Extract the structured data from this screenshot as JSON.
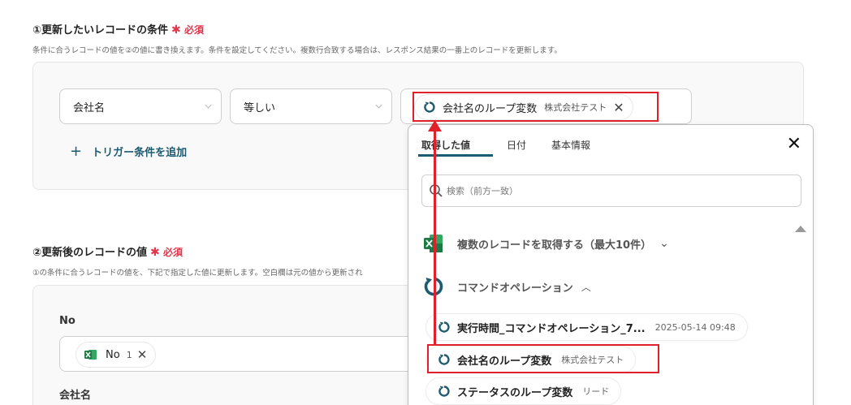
{
  "section1": {
    "title": "①更新したいレコードの条件",
    "required_star": "✱",
    "required_label": "必須",
    "description": "条件に合うレコードの値を②の値に書き換えます。条件を設定してください。複数行合致する場合は、レスポンス結果の一番上のレコードを更新します。",
    "field_select": "会社名",
    "operator_select": "等しい",
    "value_chip": {
      "label": "会社名のループ変数",
      "value": "株式会社テスト"
    },
    "add_condition": "トリガー条件を追加"
  },
  "section2": {
    "title": "②更新後のレコードの値",
    "required_star": "✱",
    "required_label": "必須",
    "description": "①の条件に合うレコードの値を、下記で指定した値に更新します。空白欄は元の値から更新され",
    "fields": [
      {
        "label": "No",
        "chip_label": "No",
        "chip_value": "1"
      },
      {
        "label": "会社名"
      }
    ]
  },
  "dropdown": {
    "tabs": [
      "取得した値",
      "日付",
      "基本情報"
    ],
    "search_placeholder": "検索（前方一致）",
    "groups": [
      {
        "label": "複数のレコードを取得する（最大10件）"
      },
      {
        "label": "コマンドオペレーション"
      }
    ],
    "items": [
      {
        "label": "実行時間_コマンドオペレーション_7...",
        "value": "2025-05-14 09:48"
      },
      {
        "label": "会社名のループ変数",
        "value": "株式会社テスト"
      },
      {
        "label": "ステータスのループ変数",
        "value": "リード"
      }
    ]
  },
  "colors": {
    "accent": "#1d5b71",
    "required": "#e0354b",
    "highlight": "#e0212b",
    "excel_green": "#1e7a45"
  }
}
